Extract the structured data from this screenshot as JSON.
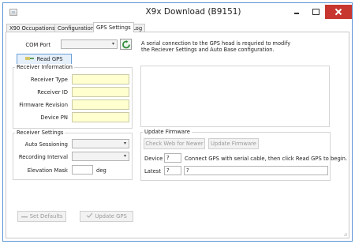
{
  "window": {
    "title": "X9x Download  (B9151)"
  },
  "tabs": [
    {
      "label": "X90 Occupations",
      "active": false
    },
    {
      "label": "Configuration",
      "active": false
    },
    {
      "label": "GPS Settings",
      "active": true
    },
    {
      "label": "Log",
      "active": false
    }
  ],
  "gps": {
    "com_port_label": "COM Port",
    "com_port_value": "",
    "read_gps_label": "Read GPS",
    "info_text": "A serial connection to the GPS head is requried to modify the Reciever Settings and Auto Base configuration."
  },
  "receiver_info": {
    "title": "Receiver Information",
    "fields": [
      {
        "label": "Receiver Type",
        "value": ""
      },
      {
        "label": "Receiver ID",
        "value": ""
      },
      {
        "label": "Firmware Revision",
        "value": ""
      },
      {
        "label": "Device PN",
        "value": ""
      }
    ]
  },
  "receiver_settings": {
    "title": "Receiver Settings",
    "auto_sessioning_label": "Auto Sessioning",
    "auto_sessioning_value": "",
    "recording_interval_label": "Recording Interval",
    "recording_interval_value": "",
    "elevation_mask_label": "Elevation Mask",
    "elevation_mask_value": "",
    "elevation_mask_unit": "deg"
  },
  "update_firmware": {
    "title": "Update Firmware",
    "check_web_label": "Check Web for Newer",
    "update_label": "Update Firmware",
    "device_label": "Device",
    "device_value": "?",
    "device_message": "Connect GPS with serial cable, then click Read GPS to begin.",
    "latest_label": "Latest",
    "latest_value": "?",
    "latest_message": "?"
  },
  "footer": {
    "set_defaults_label": "Set Defaults",
    "update_gps_label": "Update GPS"
  },
  "colors": {
    "close_red": "#c7372f",
    "highlight_yellow": "#ffffcf",
    "accent_blue": "#5a94d6"
  }
}
